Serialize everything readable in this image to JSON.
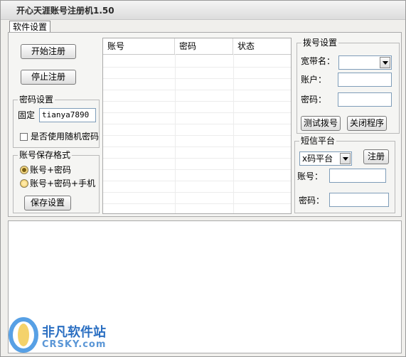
{
  "window": {
    "title": "开心天涯账号注册机1.50"
  },
  "tabs": [
    {
      "label": "软件设置"
    }
  ],
  "controls": {
    "start_label": "开始注册",
    "stop_label": "停止注册"
  },
  "password_settings": {
    "legend": "密码设置",
    "fixed_label": "固定",
    "fixed_value": "tianya7890",
    "random_label": "是否使用随机密码",
    "random_checked": false
  },
  "save_format": {
    "legend": "账号保存格式",
    "options": [
      {
        "label": "账号+密码",
        "selected": true
      },
      {
        "label": "账号+密码+手机",
        "selected": false
      }
    ],
    "save_button": "保存设置"
  },
  "grid": {
    "columns": [
      "账号",
      "密码",
      "状态"
    ],
    "rows": []
  },
  "dial_settings": {
    "legend": "拨号设置",
    "broadband_label": "宽带名：",
    "broadband_value": "",
    "account_label": "账户：",
    "account_value": "",
    "password_label": "密码：",
    "password_value": "",
    "test_button": "测试拨号",
    "close_button": "关闭程序"
  },
  "sms_platform": {
    "legend": "短信平台",
    "platform_value": "x码平台",
    "register_button": "注册",
    "account_label": "账号：",
    "account_value": "",
    "password_label": "密码：",
    "password_value": ""
  },
  "log": {
    "text": ""
  },
  "watermark": {
    "cn": "非凡软件站",
    "en": "CRSKY.com"
  }
}
